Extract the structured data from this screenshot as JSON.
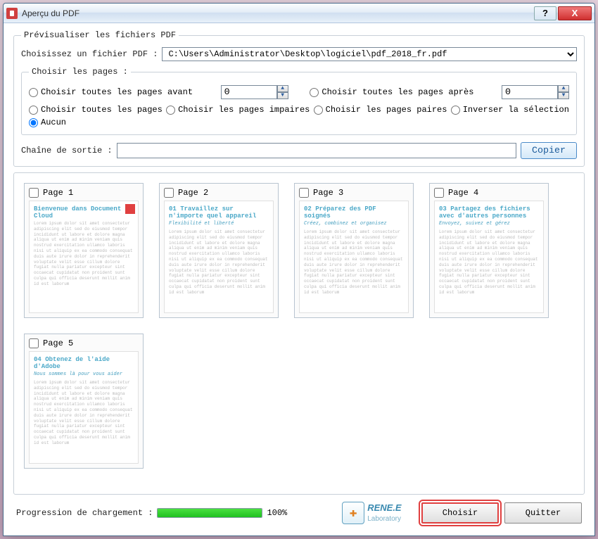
{
  "window": {
    "title": "Aperçu du PDF",
    "help_label": "?",
    "close_label": "X"
  },
  "preview_group": {
    "legend": "Prévisualiser les fichiers PDF",
    "choose_file_label": "Choisissez un fichier PDF :",
    "file_path": "C:\\Users\\Administrator\\Desktop\\logiciel\\pdf_2018_fr.pdf"
  },
  "pages_group": {
    "legend": "Choisir les pages :",
    "before_label": "Choisir toutes les pages avant",
    "before_value": "0",
    "after_label": "Choisir toutes les pages après",
    "after_value": "0",
    "all_label": "Choisir toutes les pages",
    "odd_label": "Choisir les pages impaires",
    "even_label": "Choisir les pages paires",
    "invert_label": "Inverser la sélection",
    "none_label": "Aucun"
  },
  "output": {
    "label": "Chaîne de sortie :",
    "value": "",
    "copy_label": "Copier"
  },
  "thumbnails": [
    {
      "label": "Page 1",
      "title": "Bienvenue dans Document Cloud",
      "accent": true
    },
    {
      "label": "Page 2",
      "title": "01 Travaillez sur n'importe quel appareil",
      "sub": "Flexibilité et liberté"
    },
    {
      "label": "Page 3",
      "title": "02 Préparez des PDF soignés",
      "sub": "Créez, combinez et organisez"
    },
    {
      "label": "Page 4",
      "title": "03 Partagez des fichiers avec d'autres personnes",
      "sub": "Envoyez, suivez et gérez"
    },
    {
      "label": "Page 5",
      "title": "04 Obtenez de l'aide d'Adobe",
      "sub": "Nous sommes là pour vous aider"
    }
  ],
  "bottom": {
    "progress_label": "Progression de chargement :",
    "progress_percent": "100%",
    "logo_main": "RENE.E",
    "logo_sub": "Laboratory",
    "choose_btn": "Choisir",
    "quit_btn": "Quitter"
  }
}
